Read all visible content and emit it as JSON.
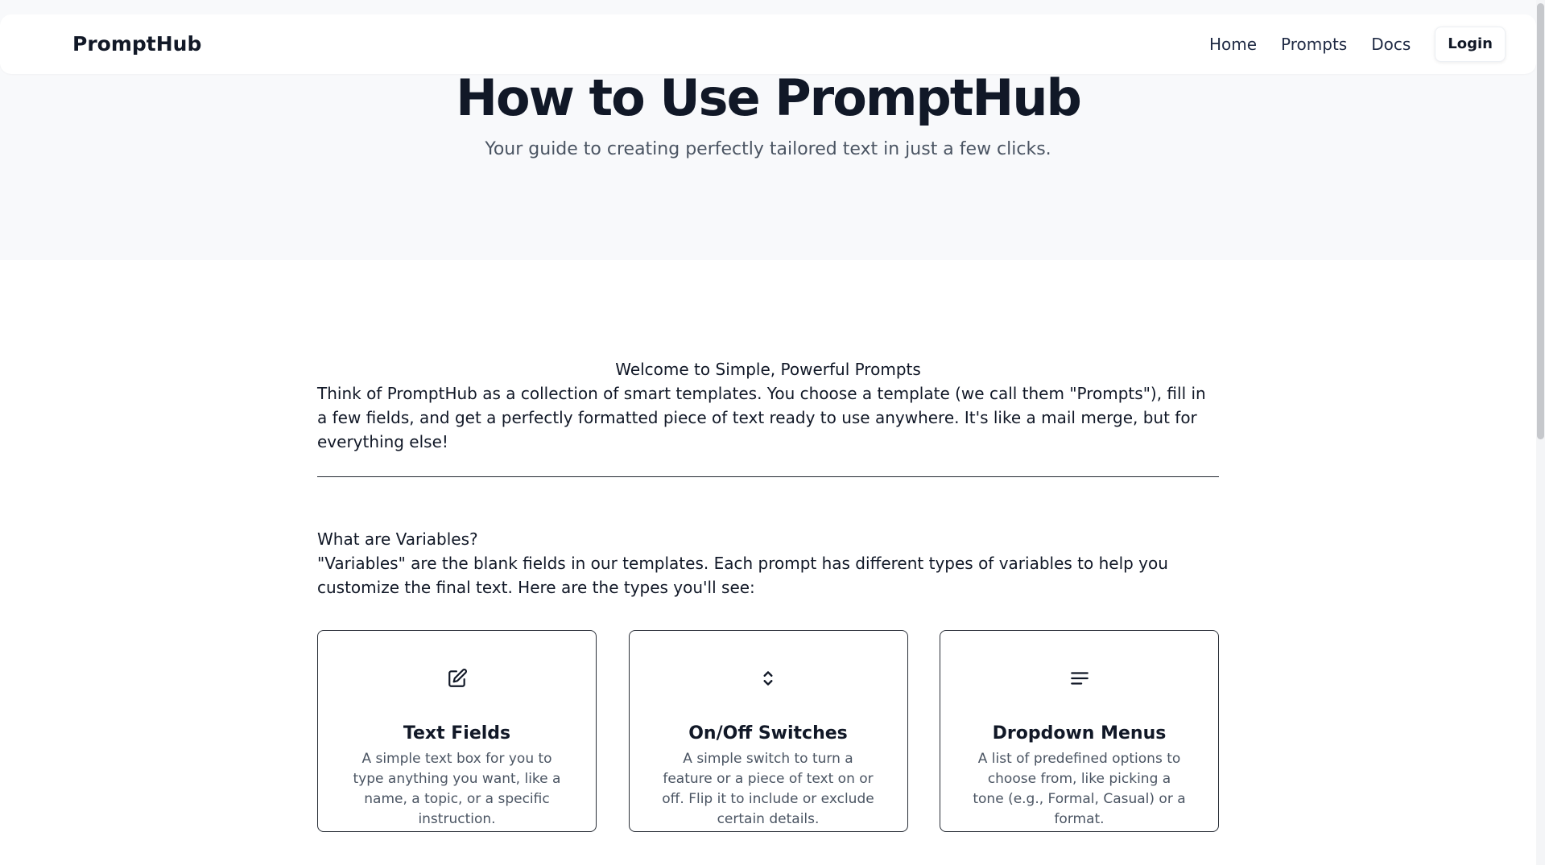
{
  "nav": {
    "brand": "PromptHub",
    "links": [
      "Home",
      "Prompts",
      "Docs"
    ],
    "login_label": "Login"
  },
  "hero": {
    "title": "How to Use PromptHub",
    "subtitle": "Your guide to creating perfectly tailored text in just a few clicks."
  },
  "intro": {
    "heading": "Welcome to Simple, Powerful Prompts",
    "body": "Think of PromptHub as a collection of smart templates. You choose a template (we call them \"Prompts\"), fill in a few fields, and get a perfectly formatted piece of text ready to use anywhere. It's like a mail merge, but for everything else!"
  },
  "variables": {
    "heading": "What are Variables?",
    "body": "\"Variables\" are the blank fields in our templates. Each prompt has different types of variables to help you customize the final text. Here are the types you'll see:",
    "cards": [
      {
        "icon": "edit-icon",
        "title": "Text Fields",
        "description": "A simple text box for you to type anything you want, like a name, a topic, or a specific instruction."
      },
      {
        "icon": "chevron-up-down-icon",
        "title": "On/Off Switches",
        "description": "A simple switch to turn a feature or a piece of text on or off. Flip it to include or exclude certain details."
      },
      {
        "icon": "lines-icon",
        "title": "Dropdown Menus",
        "description": "A list of predefined options to choose from, like picking a tone (e.g., Formal, Casual) or a format."
      }
    ]
  },
  "colors": {
    "hero_bg": "#f8f9fb",
    "text_primary": "#111827",
    "text_secondary": "#4b5563",
    "nav_link": "#1f2a44",
    "card_border": "#2a2f38"
  }
}
